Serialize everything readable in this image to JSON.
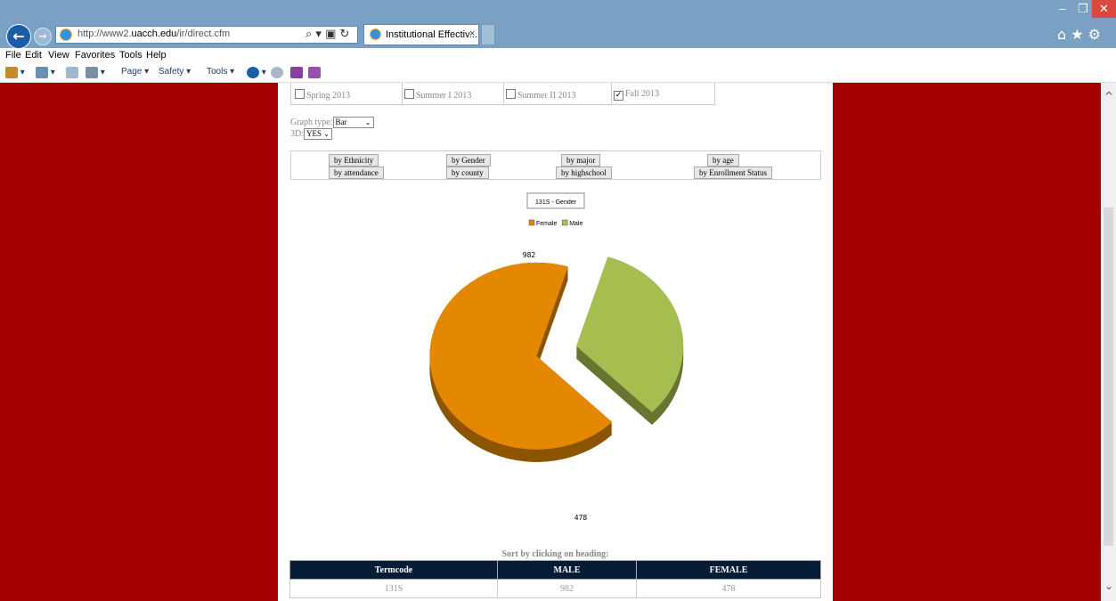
{
  "browser": {
    "url_prefix": "http://www2.",
    "url_domain": "uacch.edu",
    "url_path": "/ir/direct.cfm",
    "address_tools": "⌕ ▾ ▣ ↻",
    "tab_title": "Institutional Effectiv...",
    "tab_close": "×",
    "window_controls": {
      "min": "–",
      "max": "❐",
      "close": "✕"
    },
    "right_icons": "⌂ ★ ⚙",
    "menu": [
      "File",
      "Edit",
      "View",
      "Favorites",
      "Tools",
      "Help"
    ],
    "commands": {
      "page": "Page ▾",
      "safety": "Safety ▾",
      "tools": "Tools ▾"
    }
  },
  "filters": {
    "terms": [
      {
        "label": "Spring 2013",
        "checked": false
      },
      {
        "label": "Summer I 2013",
        "checked": false
      },
      {
        "label": "Summer II 2013",
        "checked": false
      },
      {
        "label": "Fall 2013",
        "checked": true
      }
    ],
    "graph_type_label": "Graph type:",
    "graph_type_value": "Bar",
    "threed_label": "3D:",
    "threed_value": "YES"
  },
  "group_buttons": {
    "row1": [
      "by Ethnicity",
      "by Gender",
      "by major",
      "by age"
    ],
    "row2": [
      "by attendance",
      "by county",
      "by highschool",
      "by Enrollment Status"
    ]
  },
  "chart_data": {
    "type": "pie",
    "title": "131S - Gender",
    "legend_position": "top-center",
    "categories": [
      "Female",
      "Male"
    ],
    "values": [
      982,
      478
    ],
    "colors": [
      "#e38800",
      "#a6bd4f"
    ],
    "data_labels": [
      "982",
      "478"
    ],
    "three_d": true,
    "exploded": true
  },
  "table": {
    "sort_label": "Sort by clicking on heading:",
    "headers": [
      "Termcode",
      "MALE",
      "FEMALE"
    ],
    "rows": [
      [
        "131S",
        "982",
        "478"
      ]
    ]
  },
  "colors": {
    "page_background": "#a40000",
    "table_header": "#041c35",
    "chrome": "#7aa1c4"
  }
}
